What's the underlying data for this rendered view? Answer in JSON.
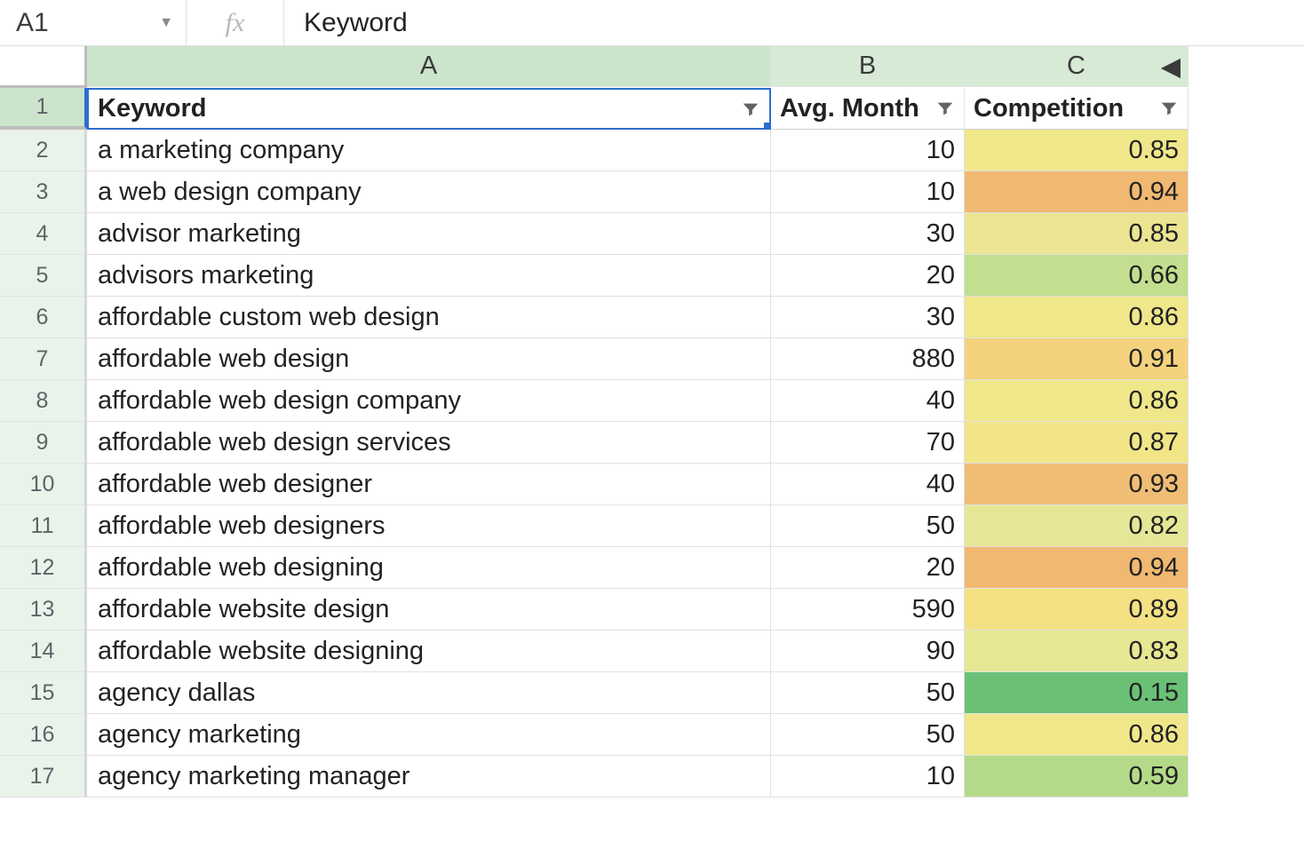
{
  "formula_bar": {
    "name_box": "A1",
    "fx_label": "fx",
    "value": "Keyword"
  },
  "columns": [
    "A",
    "B",
    "C"
  ],
  "selected_cell": "A1",
  "headers": {
    "keyword": "Keyword",
    "avg": "Avg. Month",
    "comp": "Competition"
  },
  "rows": [
    {
      "n": "2",
      "keyword": "a marketing company",
      "avg": "10",
      "comp": "0.85",
      "c": "#f0e78a"
    },
    {
      "n": "3",
      "keyword": "a web design company",
      "avg": "10",
      "comp": "0.94",
      "c": "#f0b871"
    },
    {
      "n": "4",
      "keyword": "advisor marketing",
      "avg": "30",
      "comp": "0.85",
      "c": "#ebe491"
    },
    {
      "n": "5",
      "keyword": "advisors marketing",
      "avg": "20",
      "comp": "0.66",
      "c": "#c1df8f"
    },
    {
      "n": "6",
      "keyword": "affordable custom web design",
      "avg": "30",
      "comp": "0.86",
      "c": "#f0e78a"
    },
    {
      "n": "7",
      "keyword": "affordable web design",
      "avg": "880",
      "comp": "0.91",
      "c": "#f4d27d"
    },
    {
      "n": "8",
      "keyword": "affordable web design company",
      "avg": "40",
      "comp": "0.86",
      "c": "#f0e78a"
    },
    {
      "n": "9",
      "keyword": "affordable web design services",
      "avg": "70",
      "comp": "0.87",
      "c": "#f1e588"
    },
    {
      "n": "10",
      "keyword": "affordable web designer",
      "avg": "40",
      "comp": "0.93",
      "c": "#f0bd74"
    },
    {
      "n": "11",
      "keyword": "affordable web designers",
      "avg": "50",
      "comp": "0.82",
      "c": "#e6e796"
    },
    {
      "n": "12",
      "keyword": "affordable web designing",
      "avg": "20",
      "comp": "0.94",
      "c": "#f0b871"
    },
    {
      "n": "13",
      "keyword": "affordable website design",
      "avg": "590",
      "comp": "0.89",
      "c": "#f3e184"
    },
    {
      "n": "14",
      "keyword": "affordable website designing",
      "avg": "90",
      "comp": "0.83",
      "c": "#e8e793"
    },
    {
      "n": "15",
      "keyword": "agency dallas",
      "avg": "50",
      "comp": "0.15",
      "c": "#6ac176"
    },
    {
      "n": "16",
      "keyword": "agency marketing",
      "avg": "50",
      "comp": "0.86",
      "c": "#f0e78a"
    },
    {
      "n": "17",
      "keyword": "agency marketing manager",
      "avg": "10",
      "comp": "0.59",
      "c": "#b4da89"
    }
  ]
}
